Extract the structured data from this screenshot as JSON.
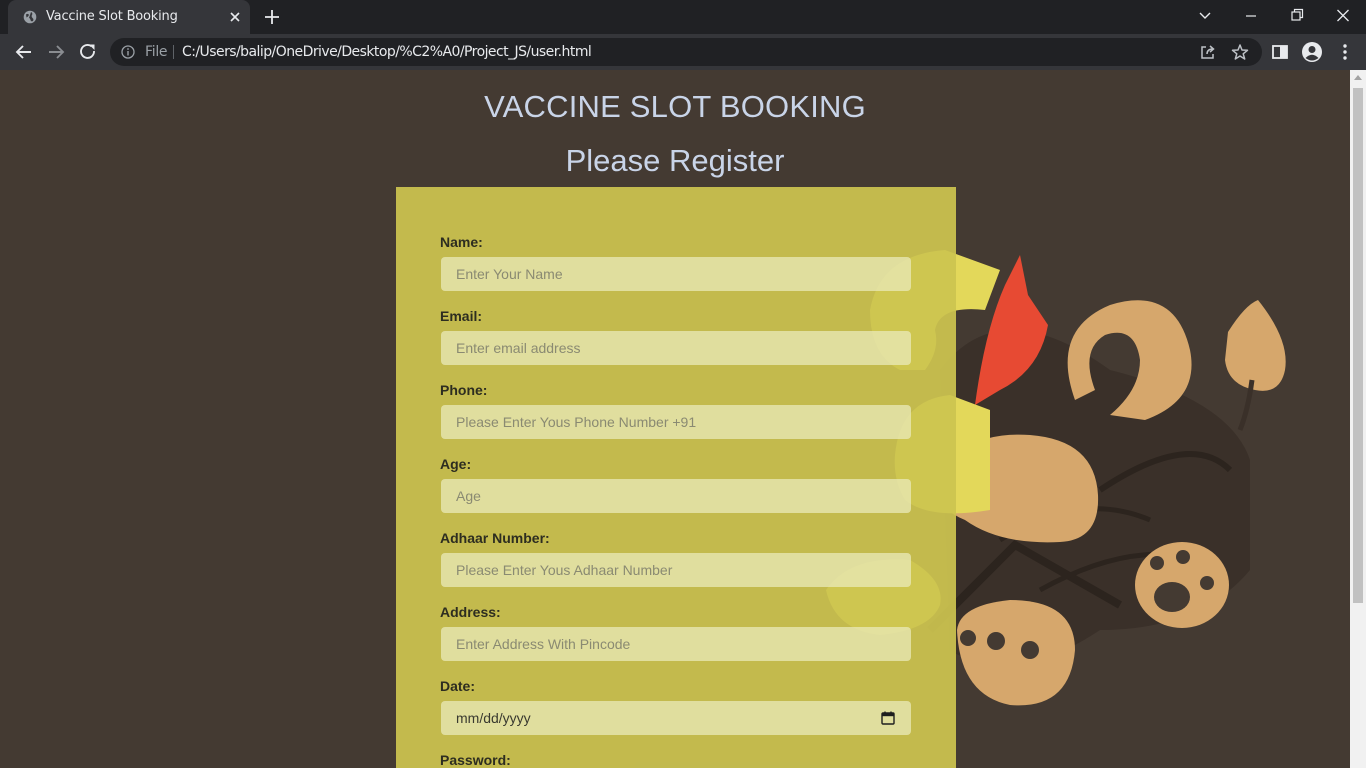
{
  "browser": {
    "tab_title": "Vaccine Slot Booking",
    "scheme_label": "File",
    "url": "C:/Users/balip/OneDrive/Desktop/%C2%A0/Project_JS/user.html"
  },
  "page": {
    "title": "VACCINE SLOT BOOKING",
    "subtitle": "Please Register"
  },
  "form": {
    "fields": [
      {
        "label": "Name:",
        "placeholder": "Enter Your Name"
      },
      {
        "label": "Email:",
        "placeholder": "Enter email address"
      },
      {
        "label": "Phone:",
        "placeholder": "Please Enter Yous Phone Number +91"
      },
      {
        "label": "Age:",
        "placeholder": "Age"
      },
      {
        "label": "Adhaar Number:",
        "placeholder": "Please Enter Yous Adhaar Number"
      },
      {
        "label": "Address:",
        "placeholder": "Enter Address With Pincode"
      }
    ],
    "date_field": {
      "label": "Date:",
      "value": "mm/dd/yyyy"
    },
    "password_label": "Password:"
  },
  "colors": {
    "page_bg": "#443a32",
    "panel": "#c8c150",
    "heading": "#c9d4e8",
    "chrome": "#35363a"
  },
  "icons": [
    "globe-icon",
    "close-icon",
    "plus-icon",
    "chevron-down-icon",
    "minimize-icon",
    "restore-icon",
    "back-arrow-icon",
    "forward-arrow-icon",
    "reload-icon",
    "info-icon",
    "share-icon",
    "star-icon",
    "side-panel-icon",
    "profile-icon",
    "kebab-menu-icon",
    "calendar-icon"
  ]
}
